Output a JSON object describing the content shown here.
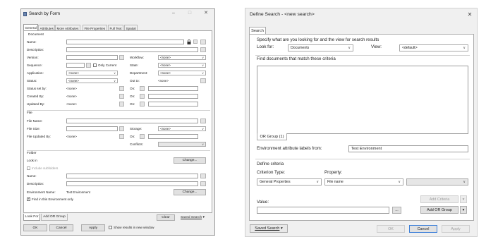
{
  "w1": {
    "title": "Search by Form",
    "tabs": [
      "General",
      "Attributes",
      "More Attributes",
      "File Properties",
      "Full Text",
      "Spatial"
    ],
    "document_group": "Document",
    "name_label": "Name:",
    "description_label": "Description:",
    "version_label": "Version:",
    "sequence_label": "Sequence:",
    "only_current_label": "Only Current",
    "application_label": "Application:",
    "application_value": "<none>",
    "status_label": "Status:",
    "status_value": "<none>",
    "status_set_by_label": "Status set by:",
    "status_set_by_value": "<none>",
    "created_by_label": "Created By:",
    "created_by_value": "<none>",
    "updated_by_label": "Updated By:",
    "updated_by_value": "<none>",
    "workflow_label": "Workflow:",
    "workflow_value": "<none>",
    "state_label": "State:",
    "state_value": "<none>",
    "department_label": "Department:",
    "department_value": "<none>",
    "out_to_label": "Out to:",
    "out_to_value": "<none>",
    "on_label": "On:",
    "file_group": "File",
    "file_name_label": "File Name:",
    "file_size_label": "File Size:",
    "file_updated_by_label": "File Updated By:",
    "file_updated_by_value": "<none>",
    "storage_label": "Storage:",
    "storage_value": "<none>",
    "conflicts_label": "Conflicts:",
    "folder_group": "Folder",
    "look_in_label": "Look in",
    "change_label": "Change...",
    "include_subfolders_label": "Include subfolders",
    "env_name_label": "Environment Name:",
    "env_name_value": "Test Environment",
    "find_in_env_label": "Find in this Environment only",
    "look_for_tab": "Look For",
    "add_or_group_tab": "Add OR Group",
    "clear_label": "Clear",
    "saved_search_label": "Saved Search",
    "ok_label": "OK",
    "cancel_label": "Cancel",
    "apply_label": "Apply",
    "show_results_label": "Show results in new window"
  },
  "w2": {
    "title": "Define Search - <new search>",
    "search_tab": "Search",
    "specify_label": "Specify what are you looking for and the view for search results",
    "look_for_label": "Look for:",
    "look_for_value": "Documents",
    "view_label": "View:",
    "view_value": "<default>",
    "find_docs_label": "Find documents that match these criteria",
    "or_group_tab": "OR Group (1)",
    "env_attr_label": "Environment attribute labels from:",
    "env_attr_value": "Test Environment",
    "define_criteria_label": "Define criteria",
    "criterion_type_label": "Criterion Type:",
    "criterion_type_value": "General Properties",
    "property_label": "Property:",
    "property_value": "File name",
    "add_criteria_label": "Add Criteria",
    "value_label": "Value:",
    "ellipsis_label": "...",
    "add_or_group_label": "Add OR Group",
    "saved_search_label": "Saved Search",
    "ok_label": "OK",
    "cancel_label": "Cancel",
    "apply_label": "Apply"
  }
}
